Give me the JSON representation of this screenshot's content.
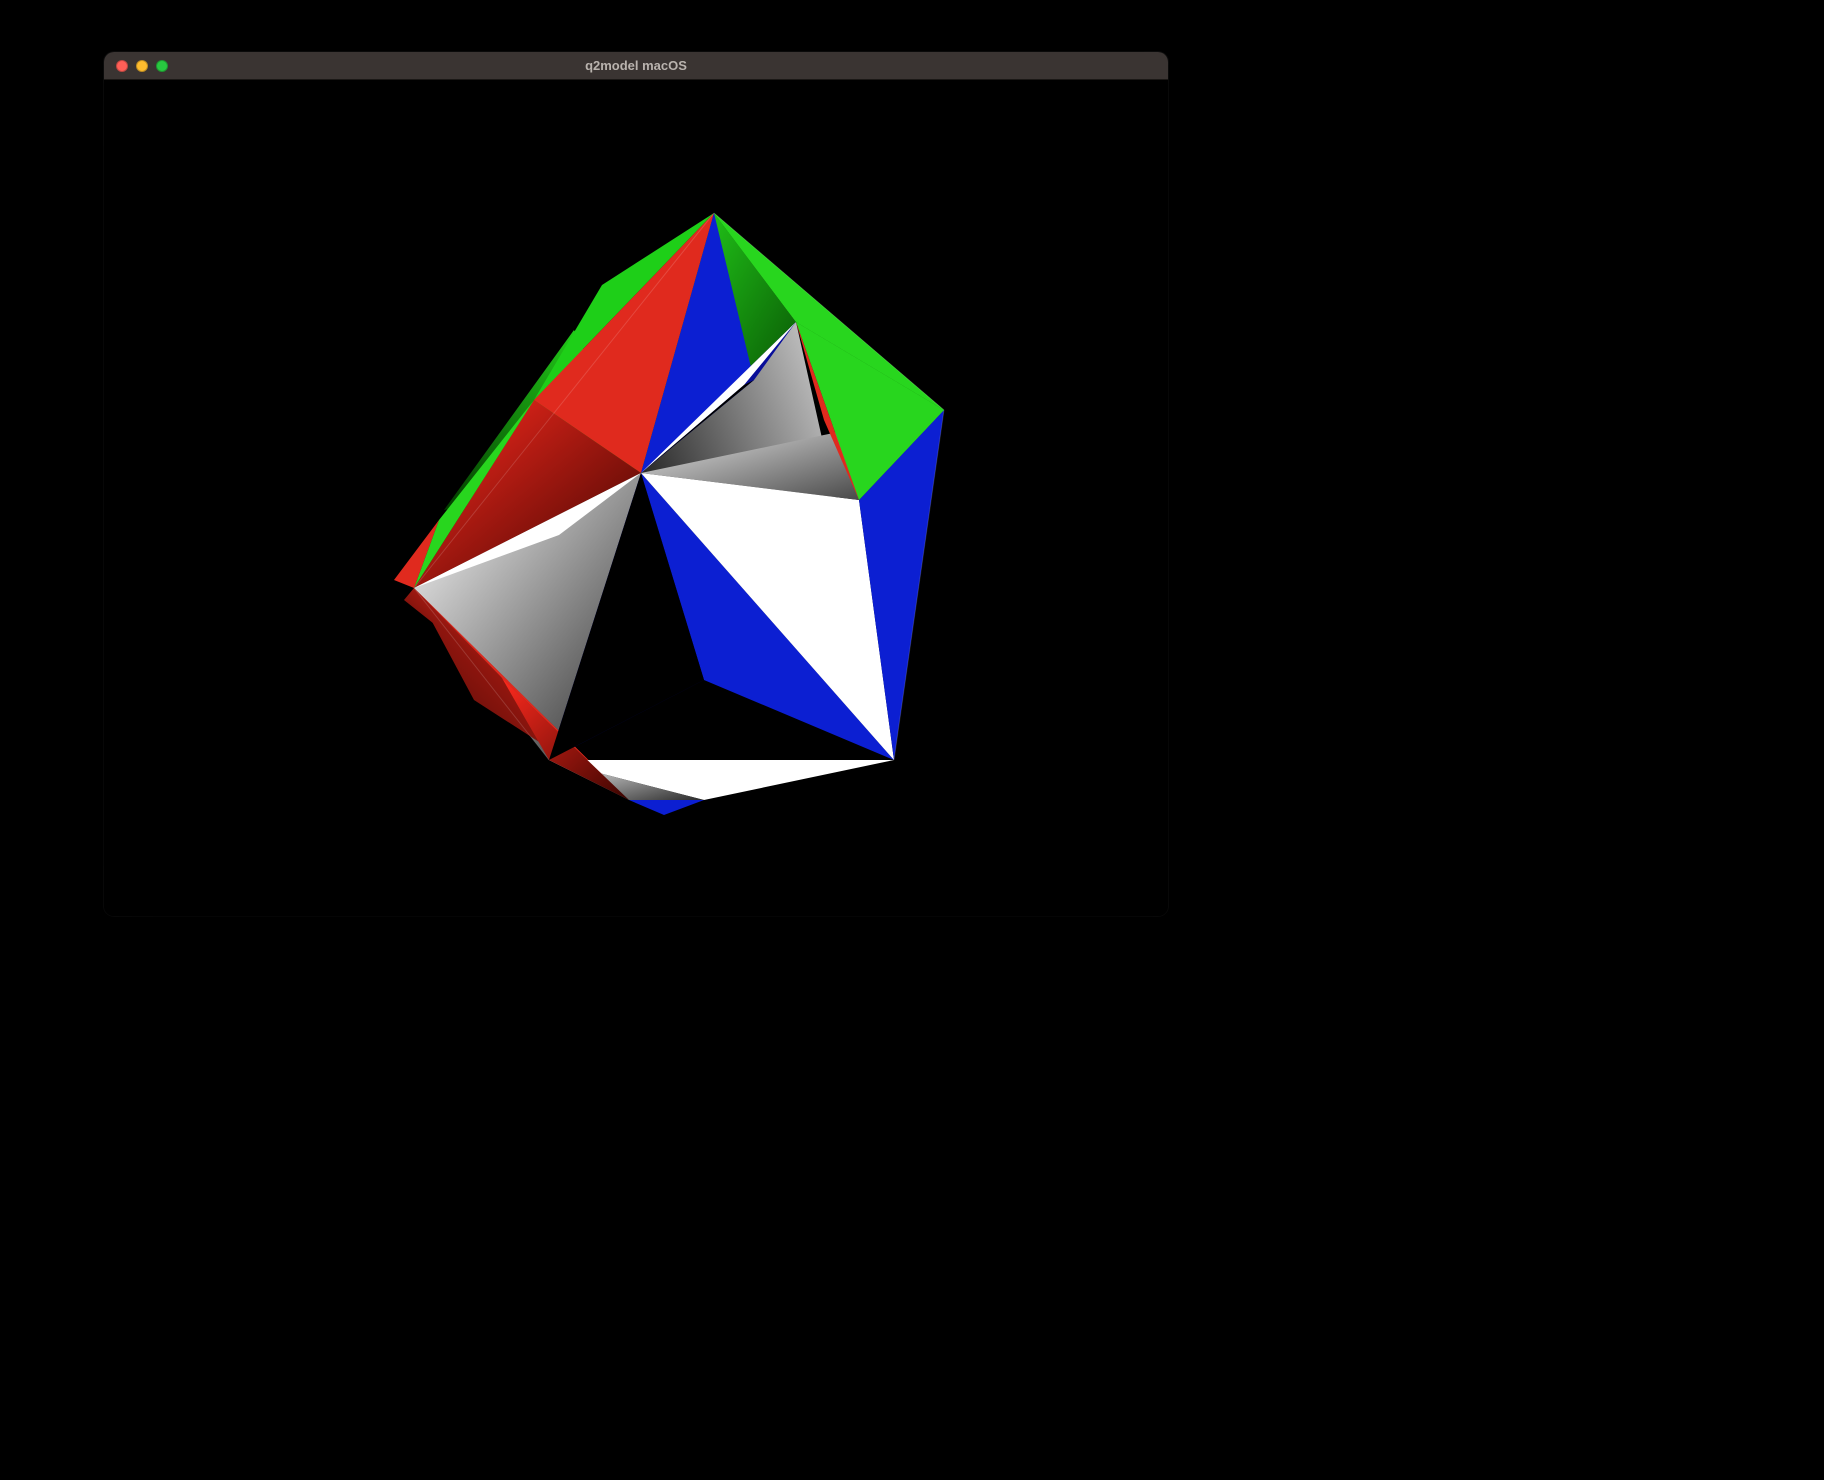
{
  "window": {
    "title": "q2model macOS",
    "traffic_lights": {
      "close": {
        "color": "#ff5f57"
      },
      "minimize": {
        "color": "#febc2e"
      },
      "zoom": {
        "color": "#28c840"
      }
    }
  },
  "viewport": {
    "background": "#000000",
    "model": {
      "description": "3D tetrahedral / polyhedral model viewer frame; triangular faces with solid and gradient fills",
      "palette": {
        "red": "#e02a1e",
        "green": "#28d61e",
        "blue": "#0c1fd2",
        "white": "#ffffff",
        "black": "#000000"
      }
    }
  }
}
